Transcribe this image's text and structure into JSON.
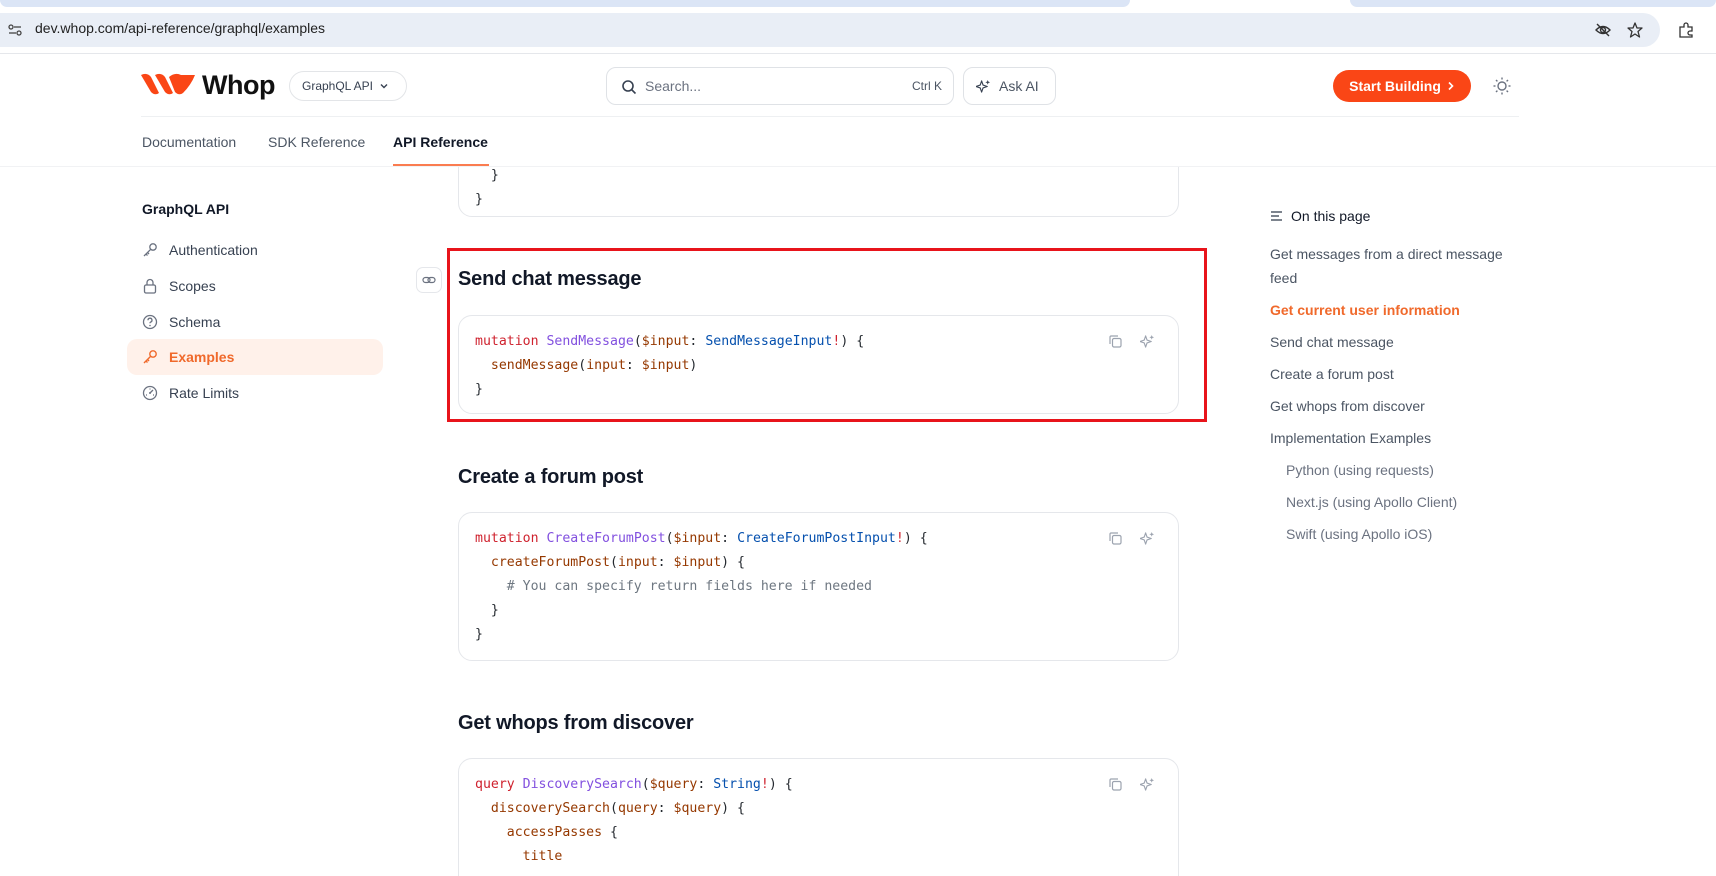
{
  "browser": {
    "url": "dev.whop.com/api-reference/graphql/examples"
  },
  "header": {
    "logo_text": "Whop",
    "api_selector": "GraphQL API",
    "search_placeholder": "Search...",
    "search_shortcut": "Ctrl K",
    "ask_ai": "Ask AI",
    "start_building": "Start Building"
  },
  "topnav": [
    {
      "label": "Documentation"
    },
    {
      "label": "SDK Reference"
    },
    {
      "label": "API Reference",
      "active": true
    }
  ],
  "sidebar": {
    "title": "GraphQL API",
    "items": [
      {
        "label": "Authentication",
        "icon": "key-icon"
      },
      {
        "label": "Scopes",
        "icon": "lock-icon"
      },
      {
        "label": "Schema",
        "icon": "question-circle-icon"
      },
      {
        "label": "Examples",
        "icon": "key-icon",
        "active": true
      },
      {
        "label": "Rate Limits",
        "icon": "gauge-icon"
      }
    ]
  },
  "content": {
    "prev_code_tail": [
      "  }",
      "}"
    ],
    "sections": [
      {
        "title": "Send chat message",
        "code": [
          "mutation SendMessage($input: SendMessageInput!) {",
          "  sendMessage(input: $input)",
          "}"
        ]
      },
      {
        "title": "Create a forum post",
        "code": [
          "mutation CreateForumPost($input: CreateForumPostInput!) {",
          "  createForumPost(input: $input) {",
          "    # You can specify return fields here if needed",
          "  }",
          "}"
        ]
      },
      {
        "title": "Get whops from discover",
        "code": [
          "query DiscoverySearch($query: String!) {",
          "  discoverySearch(query: $query) {",
          "    accessPasses {",
          "      title"
        ]
      }
    ]
  },
  "toc": {
    "heading": "On this page",
    "items": [
      {
        "label": "Get messages from a direct message feed"
      },
      {
        "label": "Get current user information",
        "active": true
      },
      {
        "label": "Send chat message"
      },
      {
        "label": "Create a forum post"
      },
      {
        "label": "Get whops from discover"
      },
      {
        "label": "Implementation Examples"
      },
      {
        "label": "Python (using requests)",
        "sub": true
      },
      {
        "label": "Next.js (using Apollo Client)",
        "sub": true
      },
      {
        "label": "Swift (using Apollo iOS)",
        "sub": true
      }
    ]
  },
  "colors": {
    "accent": "#fa4616",
    "accent_text": "#f0692b",
    "highlight_border": "#e8141b"
  }
}
